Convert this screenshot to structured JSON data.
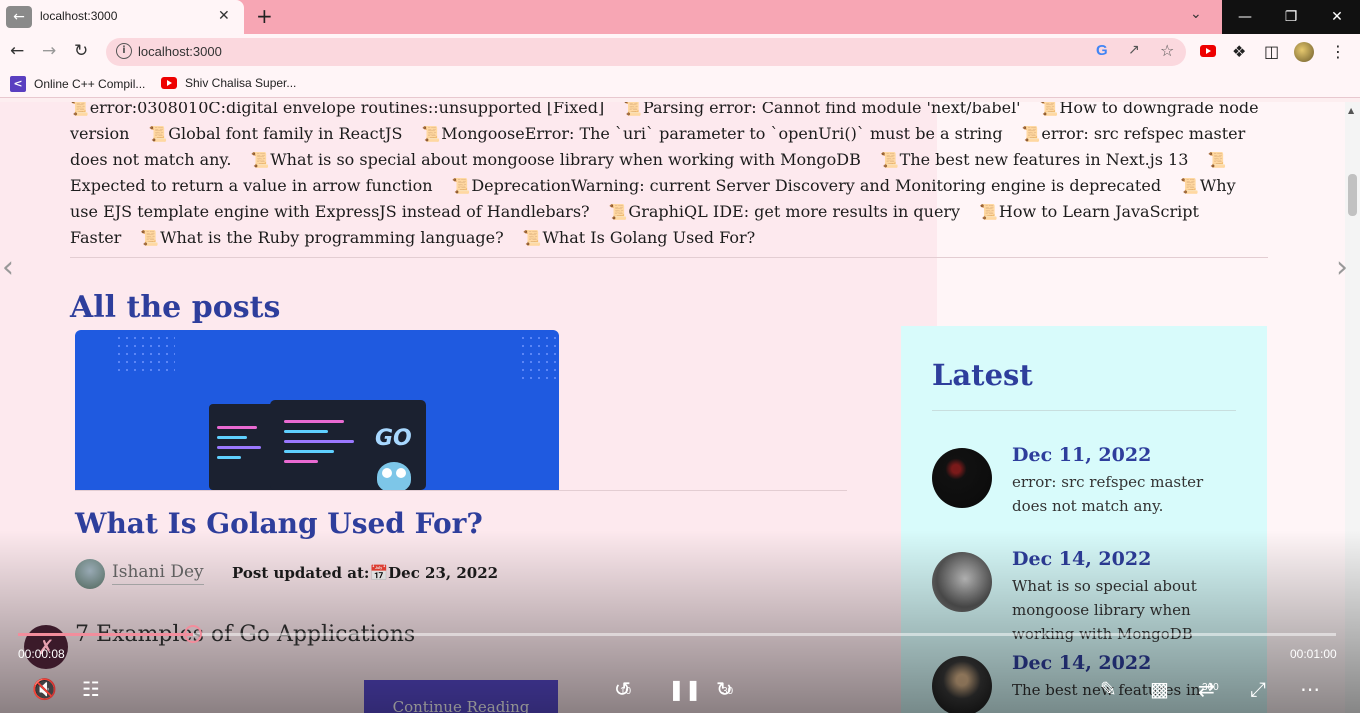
{
  "browser": {
    "tab_title": "localhost:3000",
    "url": "localhost:3000",
    "bookmarks": [
      {
        "label": "Online C++ Compil...",
        "icon": "code-icon"
      },
      {
        "label": "Shiv Chalisa Super...",
        "icon": "youtube-icon"
      }
    ]
  },
  "page": {
    "links": [
      "error:0308010C:digital envelope routines::unsupported [Fixed]",
      "Parsing error: Cannot find module 'next/babel'",
      "How to downgrade node version",
      "Global font family in ReactJS",
      "MongooseError: The `uri` parameter to `openUri()` must be a string",
      "error: src refspec master does not match any.",
      "What is so special about mongoose library when working with MongoDB",
      "The best new features in Next.js 13",
      "Expected to return a value in arrow function",
      "DeprecationWarning: current Server Discovery and Monitoring engine is deprecated",
      "Why use EJS template engine with ExpressJS instead of Handlebars?",
      "GraphiQL IDE: get more results in query",
      "How to Learn JavaScript Faster",
      "What is the Ruby programming language?",
      "What Is Golang Used For?"
    ],
    "posts_heading": "All the posts",
    "post": {
      "image_text": "GO",
      "title": "What Is Golang Used For?",
      "author": "Ishani Dey",
      "updated_label": "Post updated at:",
      "updated_date": "Dec 23, 2022",
      "subheading": "7 Examples of Go Applications",
      "continue_label": "Continue Reading"
    },
    "sidebar": {
      "title": "Latest",
      "items": [
        {
          "date": "Dec 11, 2022",
          "text": "error: src refspec master does not match any."
        },
        {
          "date": "Dec 14, 2022",
          "text": "What is so special about mongoose library when working with MongoDB"
        },
        {
          "date": "Dec 14, 2022",
          "text": "The best new features in"
        }
      ]
    }
  },
  "video": {
    "current_time": "00:00:08",
    "total_time": "00:01:00",
    "progress": 0.133,
    "rewind_label": "10",
    "forward_label": "30",
    "vr_label": "360"
  },
  "colors": {
    "accent": "#2e3e9c",
    "tabbar": "#f7a6b4",
    "sidebar_bg": "#d8fbfb",
    "progress": "#f28d9c"
  }
}
